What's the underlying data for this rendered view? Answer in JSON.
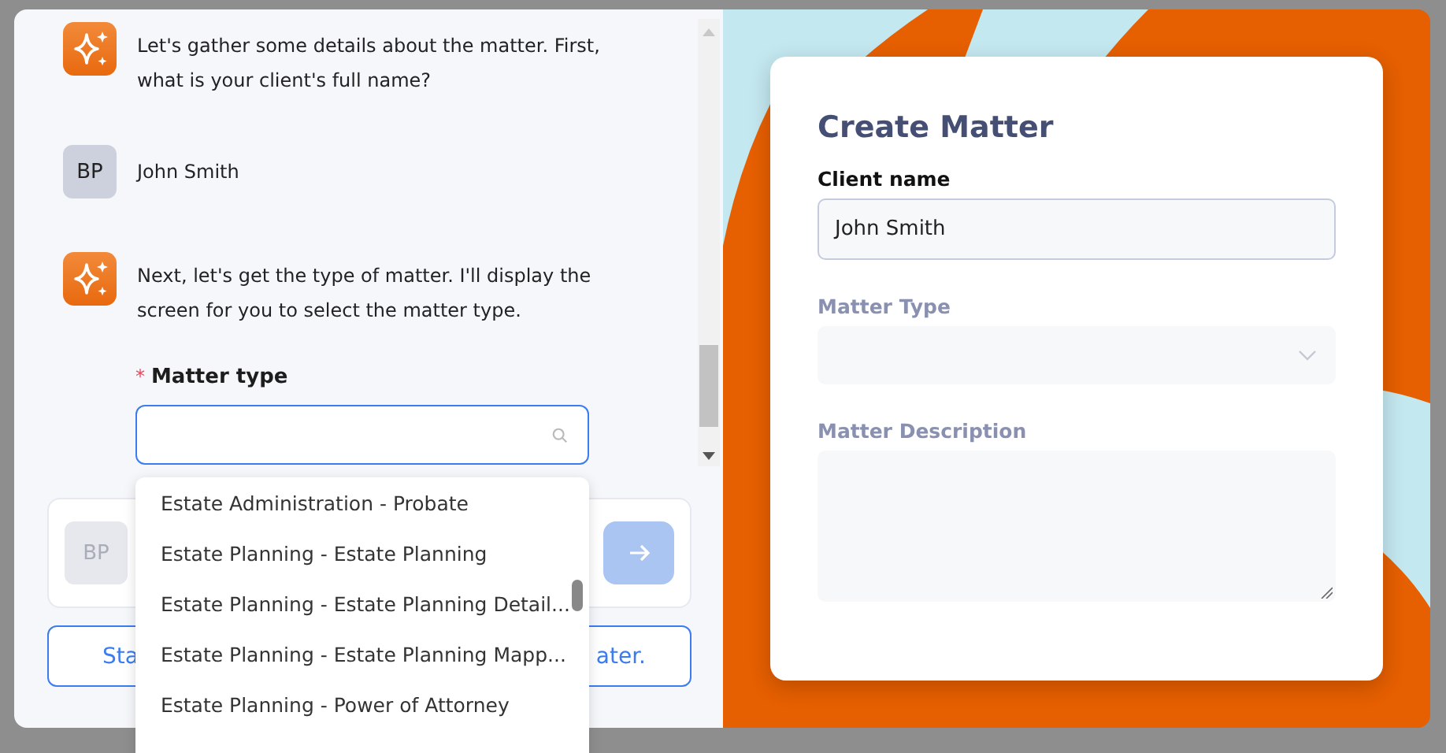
{
  "chat": {
    "messages": [
      {
        "kind": "bot",
        "text": "Let's gather some details about the matter. First, what is your client's full name?"
      },
      {
        "kind": "user",
        "avatar": "BP",
        "text": "John Smith"
      },
      {
        "kind": "bot",
        "text": "Next, let's get the type of matter. I'll display the screen for you to select the matter type."
      }
    ],
    "matter_type_field": {
      "required_mark": "*",
      "label": "Matter type",
      "focused": true
    },
    "composer": {
      "avatar": "BP",
      "send_disabled": true
    },
    "secondary_button": {
      "visible_start": "Sta",
      "visible_end": "ater."
    }
  },
  "dropdown": {
    "options": [
      {
        "label": "Estate Administration - Probate",
        "selected": false
      },
      {
        "label": "Estate Planning - Estate Planning",
        "selected": false
      },
      {
        "label": "Estate Planning - Estate Planning Detail...",
        "selected": false
      },
      {
        "label": "Estate Planning - Estate Planning Mapp...",
        "selected": false
      },
      {
        "label": "Estate Planning - Power of Attorney",
        "selected": false
      }
    ]
  },
  "form": {
    "title": "Create Matter",
    "fields": [
      {
        "kind": "text",
        "label": "Client name",
        "value": "John Smith",
        "disabled": false
      },
      {
        "kind": "select",
        "label": "Matter Type",
        "disabled": true
      },
      {
        "kind": "textarea",
        "label": "Matter Description",
        "disabled": true
      }
    ]
  }
}
